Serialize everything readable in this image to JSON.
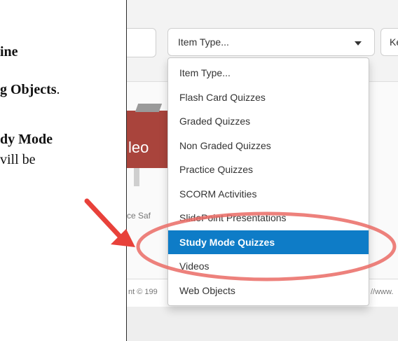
{
  "document": {
    "lines": [
      {
        "pre": "",
        "bold": "ine",
        "post": ""
      },
      {
        "pre": "",
        "bold": "g Objects",
        "post": "."
      },
      {
        "pre": "",
        "bold": "dy Mode",
        "post": ""
      },
      {
        "pre": "vill be",
        "bold": "",
        "post": ""
      }
    ]
  },
  "toolbar": {
    "item_type_label": "Item Type...",
    "right_button_label": "Ke"
  },
  "menu": {
    "items": [
      "Item Type...",
      "Flash Card Quizzes",
      "Graded Quizzes",
      "Non Graded Quizzes",
      "Practice Quizzes",
      "SCORM Activities",
      "SlidePoint Presentations",
      "Study Mode Quizzes",
      "Videos",
      "Web Objects"
    ],
    "selected": "Study Mode Quizzes"
  },
  "background": {
    "video_text": "leo",
    "caption": "ce Saf",
    "footer_left": "nt © 199",
    "footer_right": "//www."
  },
  "colors": {
    "highlight": "#0e7cc7",
    "annotation": "#e8413a"
  }
}
